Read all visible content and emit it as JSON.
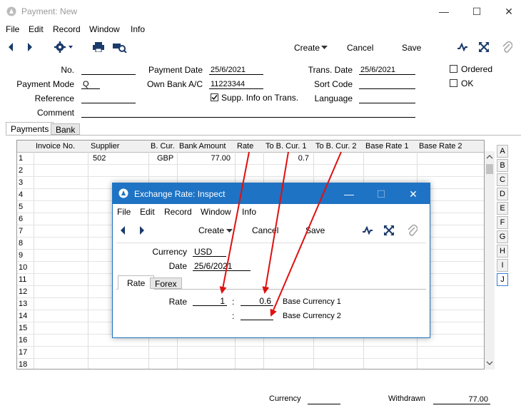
{
  "window": {
    "title": "Payment: New",
    "controls": {
      "minimize": "—",
      "maximize": "☐",
      "close": "✕"
    }
  },
  "menu": [
    "File",
    "Edit",
    "Record",
    "Window",
    "Info"
  ],
  "toolbar": {
    "create_label": "Create",
    "cancel_label": "Cancel",
    "save_label": "Save"
  },
  "header": {
    "no_label": "No.",
    "no_value": "",
    "payment_mode_label": "Payment Mode",
    "payment_mode_value": "Q",
    "reference_label": "Reference",
    "reference_value": "",
    "comment_label": "Comment",
    "comment_value": "",
    "payment_date_label": "Payment Date",
    "payment_date_value": "25/6/2021",
    "own_bank_label": "Own Bank A/C",
    "own_bank_value": "11223344",
    "supp_info_label": "Supp. Info on Trans.",
    "supp_info_checked": true,
    "trans_date_label": "Trans. Date",
    "trans_date_value": "25/6/2021",
    "sort_code_label": "Sort Code",
    "sort_code_value": "",
    "language_label": "Language",
    "language_value": "",
    "ordered_label": "Ordered",
    "ok_label": "OK"
  },
  "tabs": [
    "Payments",
    "Bank"
  ],
  "grid": {
    "columns": [
      "Invoice No.",
      "Supplier",
      "B. Cur.",
      "Bank Amount",
      "Rate",
      "To B. Cur. 1",
      "To B. Cur. 2",
      "Base Rate 1",
      "Base Rate 2"
    ],
    "rows": [
      "1",
      "2",
      "3",
      "4",
      "5",
      "6",
      "7",
      "8",
      "9",
      "10",
      "11",
      "12",
      "13",
      "14",
      "15",
      "16",
      "17",
      "18"
    ],
    "row1": {
      "supplier": "502",
      "bcur": "GBP",
      "bank_amount": "77.00",
      "to_bcur1": "0.7"
    }
  },
  "side_tabs": [
    "A",
    "B",
    "C",
    "D",
    "E",
    "F",
    "G",
    "H",
    "I",
    "J"
  ],
  "footer": {
    "currency_label": "Currency",
    "currency_value": "",
    "withdrawn_label": "Withdrawn",
    "withdrawn_value": "77.00"
  },
  "dialog": {
    "title": "Exchange Rate: Inspect",
    "controls": {
      "minimize": "—",
      "maximize": "☐",
      "close": "✕"
    },
    "menu": [
      "File",
      "Edit",
      "Record",
      "Window",
      "Info"
    ],
    "toolbar": {
      "create_label": "Create",
      "cancel_label": "Cancel",
      "save_label": "Save"
    },
    "currency_label": "Currency",
    "currency_value": "USD",
    "date_label": "Date",
    "date_value": "25/6/2021",
    "tabs": [
      "Rate",
      "Forex"
    ],
    "rate_label": "Rate",
    "rate_value": "1",
    "colon": ":",
    "base1_value": "0.6",
    "base1_label": "Base Currency 1",
    "base2_value": "",
    "base2_label": "Base Currency 2"
  },
  "colors": {
    "accent": "#1e73c4",
    "arrow": "#e01010"
  }
}
